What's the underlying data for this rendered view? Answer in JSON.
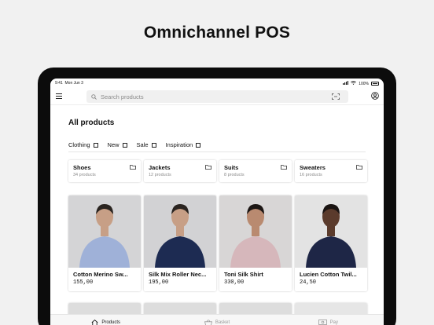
{
  "headline": "Omnichannel POS",
  "status": {
    "time": "9:41",
    "date": "Mon Jun 3",
    "battery": "100%"
  },
  "search": {
    "placeholder": "Search products"
  },
  "page_title": "All products",
  "filters": [
    {
      "label": "Clothing",
      "checked": false
    },
    {
      "label": "New",
      "checked": false
    },
    {
      "label": "Sale",
      "checked": false
    },
    {
      "label": "Inspiration",
      "checked": false
    }
  ],
  "categories": [
    {
      "name": "Shoes",
      "count": "34 products"
    },
    {
      "name": "Jackets",
      "count": "12 products"
    },
    {
      "name": "Suits",
      "count": "8 products"
    },
    {
      "name": "Sweaters",
      "count": "16 products"
    }
  ],
  "products": [
    {
      "name": "Cotton Merino Sw...",
      "price": "155,00",
      "bg": "#d4d4d6",
      "top": "#9fb1d8",
      "skin": "#c79f86",
      "hair": "#2a2420"
    },
    {
      "name": "Silk Mix Roller Nec...",
      "price": "195,00",
      "bg": "#d2d2d4",
      "top": "#1d2b52",
      "skin": "#c79f86",
      "hair": "#2a2420"
    },
    {
      "name": "Toni Silk Shirt",
      "price": "330,00",
      "bg": "#d8d6d6",
      "top": "#d6b7bb",
      "skin": "#b98a70",
      "hair": "#1c1614"
    },
    {
      "name": "Lucien Cotton Twil...",
      "price": "24,50",
      "bg": "#e3e3e3",
      "top": "#1e2646",
      "skin": "#5b3b2c",
      "hair": "#1a1412"
    }
  ],
  "tabs": [
    {
      "label": "Products",
      "icon": "home-icon",
      "active": true
    },
    {
      "label": "Basket",
      "icon": "basket-icon",
      "active": false
    },
    {
      "label": "Pay",
      "icon": "cash-icon",
      "active": false
    }
  ]
}
